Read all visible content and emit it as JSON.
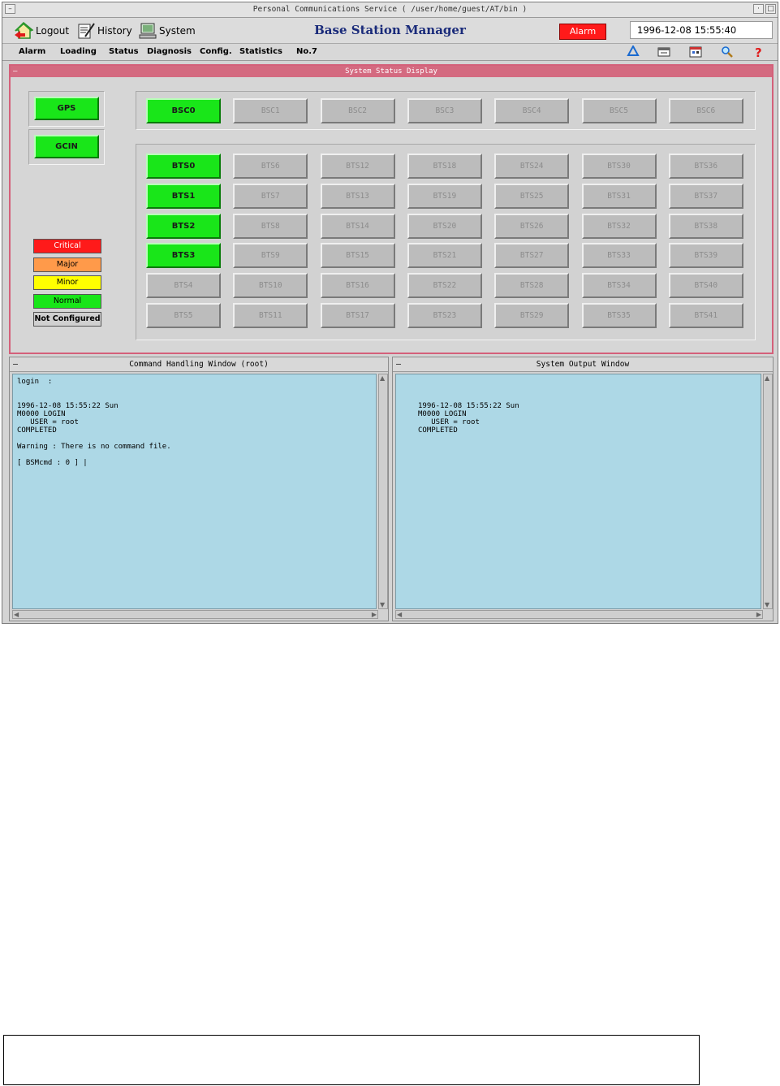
{
  "window": {
    "title": "Personal Communications Service ( /user/home/guest/AT/bin )"
  },
  "toolbar": {
    "logout_label": "Logout",
    "history_label": "History",
    "system_label": "System",
    "app_name": "Base Station Manager",
    "alarm_label": "Alarm",
    "clock": "1996-12-08 15:55:40"
  },
  "menu": {
    "items": [
      "Alarm",
      "Loading",
      "Status",
      "Diagnosis",
      "Config.",
      "Statistics",
      "No.7"
    ],
    "icons": [
      "recycle-icon",
      "window-icon",
      "calendar-icon",
      "search-icon",
      "help-icon"
    ]
  },
  "status_display": {
    "title": "System Status Display",
    "units": [
      "GPS",
      "GCIN"
    ],
    "bsc": [
      {
        "label": "BSC0",
        "state": "normal"
      },
      {
        "label": "BSC1",
        "state": "not-configured"
      },
      {
        "label": "BSC2",
        "state": "not-configured"
      },
      {
        "label": "BSC3",
        "state": "not-configured"
      },
      {
        "label": "BSC4",
        "state": "not-configured"
      },
      {
        "label": "BSC5",
        "state": "not-configured"
      },
      {
        "label": "BSC6",
        "state": "not-configured"
      }
    ],
    "bts_columns": [
      [
        "BTS0",
        "BTS1",
        "BTS2",
        "BTS3",
        "BTS4",
        "BTS5"
      ],
      [
        "BTS6",
        "BTS7",
        "BTS8",
        "BTS9",
        "BTS10",
        "BTS11"
      ],
      [
        "BTS12",
        "BTS13",
        "BTS14",
        "BTS15",
        "BTS16",
        "BTS17"
      ],
      [
        "BTS18",
        "BTS19",
        "BTS20",
        "BTS21",
        "BTS22",
        "BTS23"
      ],
      [
        "BTS24",
        "BTS25",
        "BTS26",
        "BTS27",
        "BTS28",
        "BTS29"
      ],
      [
        "BTS30",
        "BTS31",
        "BTS32",
        "BTS33",
        "BTS34",
        "BTS35"
      ],
      [
        "BTS36",
        "BTS37",
        "BTS38",
        "BTS39",
        "BTS40",
        "BTS41"
      ]
    ],
    "active_bts": [
      "BTS0",
      "BTS1",
      "BTS2",
      "BTS3"
    ],
    "legend": [
      {
        "label": "Critical",
        "color": "#ff1a1a",
        "text": "#ffffff"
      },
      {
        "label": "Major",
        "color": "#ff9a4a",
        "text": "#000000"
      },
      {
        "label": "Minor",
        "color": "#ffff00",
        "text": "#000000"
      },
      {
        "label": "Normal",
        "color": "#19e619",
        "text": "#000000"
      },
      {
        "label": "Not Configured",
        "color": "#d0d0d0",
        "text": "#000000"
      }
    ]
  },
  "command_window": {
    "title": "Command Handling Window (root)",
    "lines": [
      "login  :",
      "",
      "",
      "1996-12-08 15:55:22 Sun",
      "M0000 LOGIN",
      "   USER = root",
      "COMPLETED",
      "",
      "Warning : There is no command file.",
      "",
      "[ BSMcmd : 0 ] |"
    ]
  },
  "output_window": {
    "title": "System Output Window",
    "lines": [
      "",
      "",
      "",
      "1996-12-08 15:55:22 Sun",
      "M0000 LOGIN",
      "   USER = root",
      "COMPLETED"
    ]
  }
}
